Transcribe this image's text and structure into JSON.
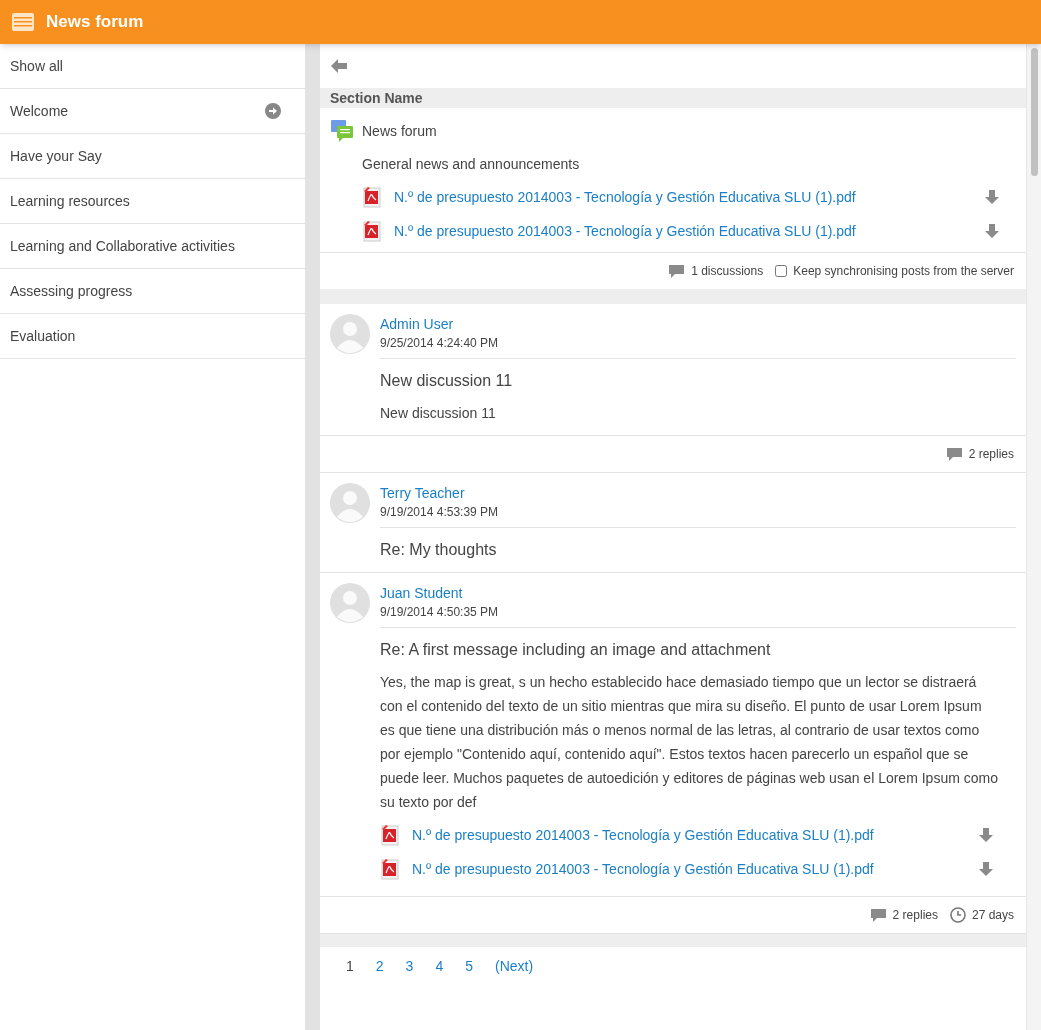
{
  "header": {
    "title": "News forum"
  },
  "sidebar": {
    "items": [
      {
        "label": "Show all",
        "arrow": false
      },
      {
        "label": "Welcome",
        "arrow": true
      },
      {
        "label": "Have your Say",
        "arrow": false
      },
      {
        "label": "Learning resources",
        "arrow": false
      },
      {
        "label": "Learning and Collaborative activities",
        "arrow": false
      },
      {
        "label": "Assessing progress",
        "arrow": false
      },
      {
        "label": "Evaluation",
        "arrow": false
      }
    ]
  },
  "section": {
    "name": "Section Name",
    "forum": {
      "name": "News forum",
      "description": "General news and announcements",
      "attachments": [
        "N.º de presupuesto 2014003 - Tecnología y Gestión Educativa SLU (1).pdf",
        "N.º de presupuesto 2014003 - Tecnología y Gestión Educativa SLU (1).pdf"
      ]
    },
    "discussions": "1 discussions",
    "sync": {
      "label": "Keep synchronising posts from the server",
      "checked": false
    }
  },
  "posts": [
    {
      "author": "Admin User",
      "date": "9/25/2014 4:24:40 PM",
      "subject": "New discussion 11",
      "body": "New discussion 11",
      "replies": "2 replies"
    },
    {
      "author": "Terry Teacher",
      "date": "9/19/2014 4:53:39 PM",
      "subject": "Re: My thoughts"
    },
    {
      "author": "Juan Student",
      "date": "9/19/2014 4:50:35 PM",
      "subject": "Re: A first message including an image and attachment",
      "body": "Yes, the map is great, s un hecho establecido hace demasiado tiempo que un lector se distraerá con el contenido del texto de un sitio mientras que mira su diseño. El punto de usar Lorem Ipsum es que tiene una distribución más o menos normal de las letras, al contrario de usar textos como por ejemplo \"Contenido aquí, contenido aquí\". Estos textos hacen parecerlo un español que se puede leer. Muchos paquetes de autoedición y editores de páginas web usan el Lorem Ipsum como su texto por def",
      "attachments": [
        "N.º de presupuesto 2014003 - Tecnología y Gestión Educativa SLU (1).pdf",
        "N.º de presupuesto 2014003 - Tecnología y Gestión Educativa SLU (1).pdf"
      ],
      "replies": "2 replies",
      "age": "27 days"
    }
  ],
  "pagination": [
    {
      "label": "1",
      "selected": true
    },
    {
      "label": "2",
      "selected": false
    },
    {
      "label": "3",
      "selected": false
    },
    {
      "label": "4",
      "selected": false
    },
    {
      "label": "5",
      "selected": false
    },
    {
      "label": "(Next)",
      "selected": false
    }
  ]
}
